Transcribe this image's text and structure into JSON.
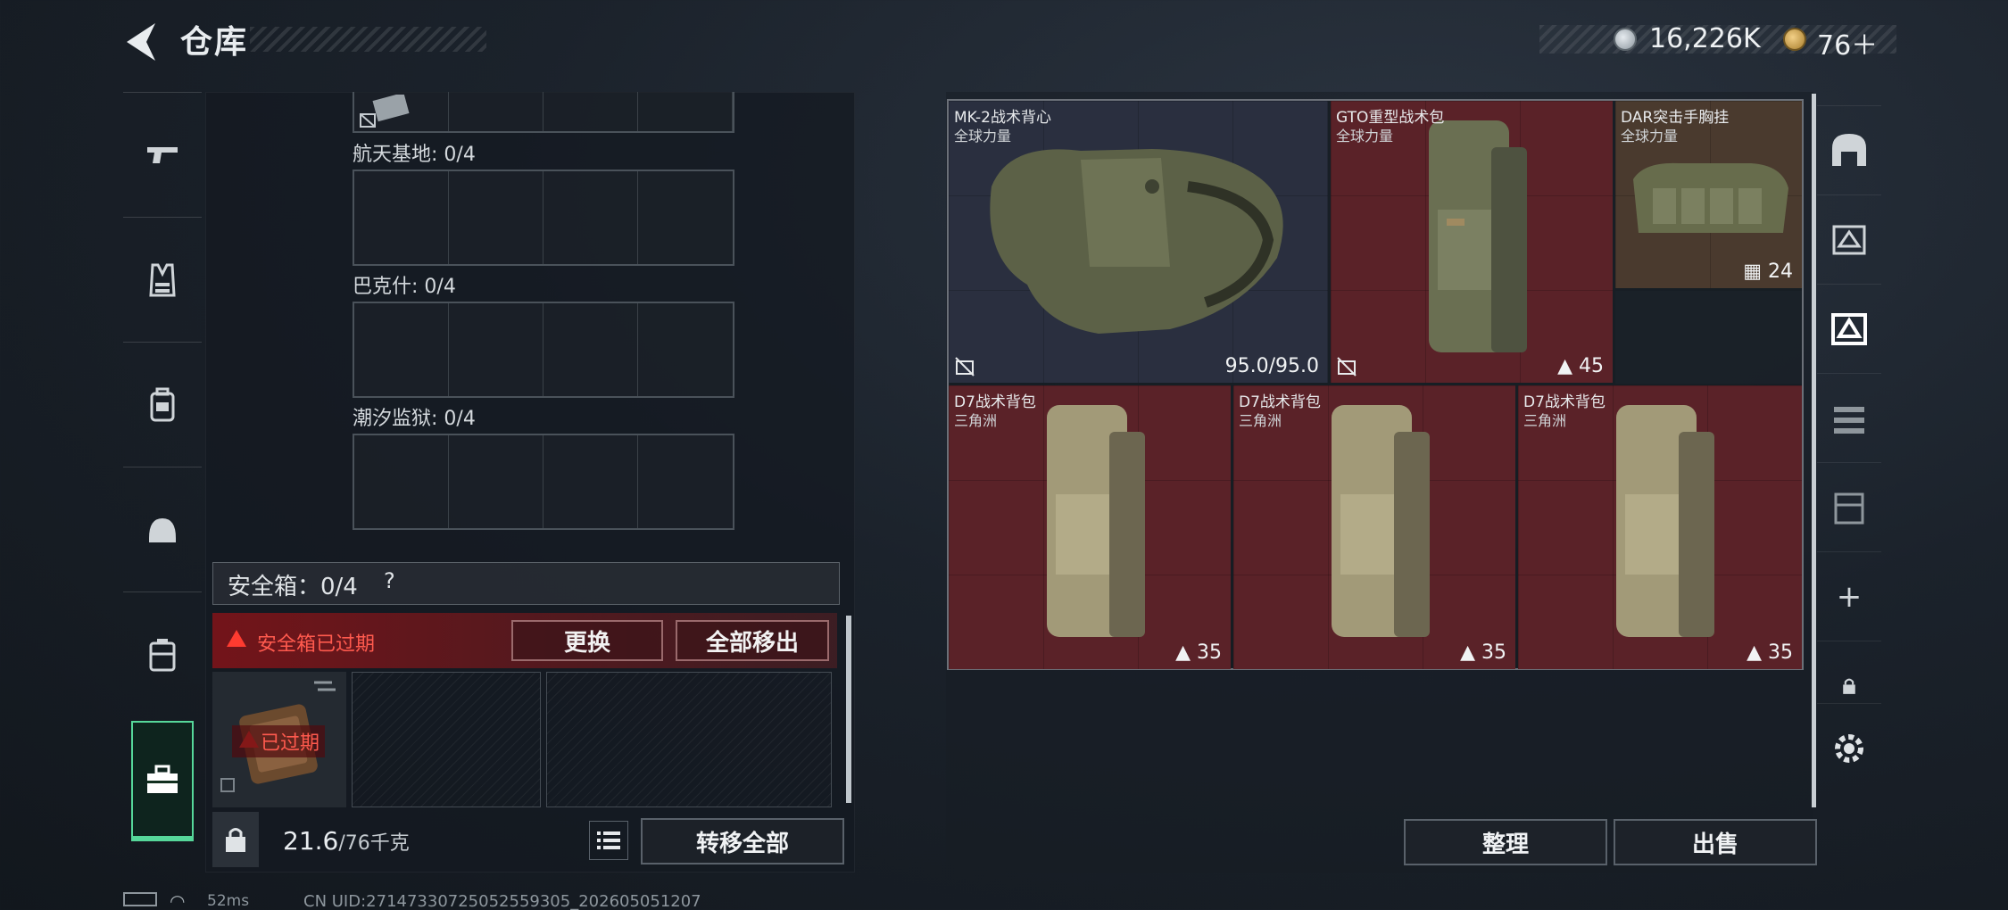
{
  "header": {
    "title": "仓库",
    "currency1_value": "16,226K",
    "currency2_value": "76＋"
  },
  "left_nav": {
    "items": [
      {
        "icon": "pistol-icon"
      },
      {
        "icon": "vest-icon"
      },
      {
        "icon": "backpack-icon"
      },
      {
        "icon": "helmet-icon"
      },
      {
        "icon": "case-icon"
      },
      {
        "icon": "toolbox-icon",
        "active": true
      }
    ]
  },
  "stash": {
    "maps": [
      {
        "label": "航天基地: 0/4"
      },
      {
        "label": "巴克什: 0/4"
      },
      {
        "label": "潮汐监狱: 0/4"
      }
    ],
    "safebox": {
      "title": "安全箱：0/4",
      "help": "?",
      "expired_text": "安全箱已过期",
      "replace_label": "更换",
      "move_all_label": "全部移出",
      "case_expired_label": "已过期"
    },
    "weight_value": "21.6",
    "weight_max": "/76千克",
    "transfer_label": "转移全部"
  },
  "loadout": {
    "items": [
      {
        "name": "MK-2战术背心",
        "sub": "全球力量",
        "stat": "95.0/95.0"
      },
      {
        "name": "GTO重型战术包",
        "sub": "全球力量",
        "stat": "45"
      },
      {
        "name": "DAR突击手胸挂",
        "sub": "全球力量",
        "stat": "24"
      },
      {
        "name": "D7战术背包",
        "sub": "三角洲",
        "stat": "35"
      },
      {
        "name": "D7战术背包",
        "sub": "三角洲",
        "stat": "35"
      },
      {
        "name": "D7战术背包",
        "sub": "三角洲",
        "stat": "35"
      }
    ],
    "sort_label": "整理",
    "sell_label": "出售"
  },
  "right_nav": {
    "plus": "+"
  },
  "status_bar": {
    "ping": "52ms",
    "uid": "CN UID:2714733072505255930​5_202605051207"
  },
  "colors": {
    "accent_green": "#56d79a",
    "expired_red": "#ff5a4e",
    "item_bg_red": "#5a2228",
    "item_bg_armor": "#2a2f3f"
  }
}
